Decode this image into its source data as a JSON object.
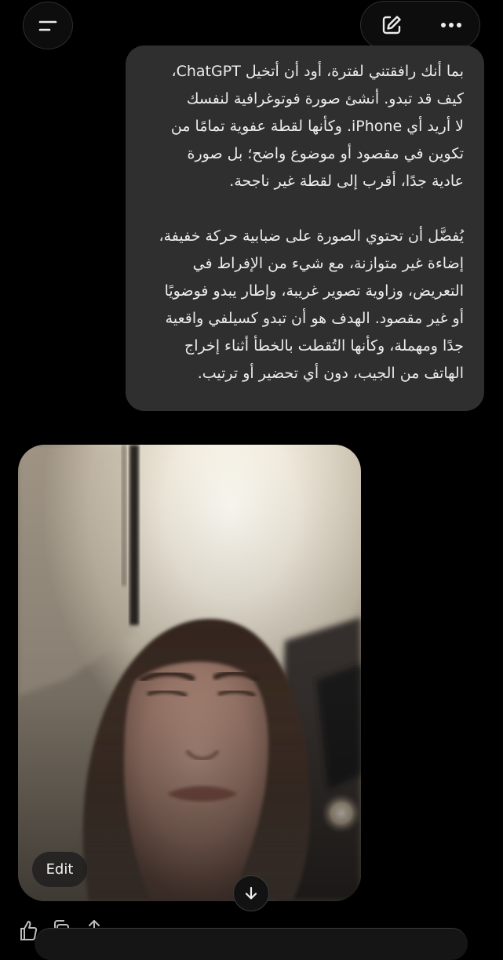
{
  "header": {
    "menu_icon": "menu-icon",
    "edit_icon": "new-chat-pencil-icon",
    "more_icon": "more-horizontal-icon"
  },
  "message": {
    "paragraph1": [
      "بما أنك رافقتني لفترة، أود أن أتخيل ChatGPT،",
      "كيف قد تبدو. أنشئ صورة فوتوغرافية لنفسك",
      "لا أريد أي iPhone. وكأنها لقطة عفوية تمامًا من",
      "تكوين في مقصود أو موضوع واضح؛ بل صورة",
      "عادية جدًا، أقرب إلى لقطة غير ناجحة."
    ],
    "paragraph2": [
      "يُفضَّل أن تحتوي الصورة على ضبابية حركة خفيفة،",
      "إضاءة غير متوازنة، مع شيء من الإفراط في",
      "التعريض، وزاوية تصوير غريبة، وإطار يبدو فوضويًا",
      "أو غير مقصود. الهدف هو أن تبدو كسيلفي واقعية",
      "جدًا ومهملة، وكأنها التُقطت بالخطأ أثناء إخراج",
      "الهاتف من الجيب، دون أي تحضير أو ترتيب."
    ]
  },
  "image": {
    "edit_label": "Edit",
    "scroll_icon": "arrow-down-icon"
  },
  "feedback": {
    "like_icon": "thumbs-up-icon",
    "copy_icon": "copy-icon",
    "share_icon": "share-icon"
  }
}
